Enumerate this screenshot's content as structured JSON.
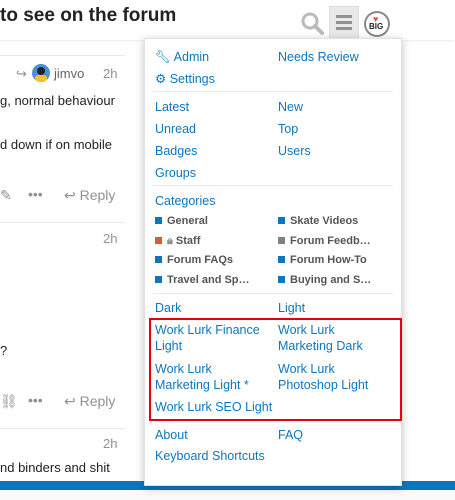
{
  "header": {
    "title": "to see on the forum",
    "search_icon": "search-icon",
    "menu_icon": "hamburger-icon",
    "avatar_icon": "user-avatar"
  },
  "posts": [
    {
      "user": "jimvo",
      "time": "2h",
      "lines": [
        "g, normal behaviour",
        "d down if on mobile"
      ],
      "more": "•••",
      "reply": "Reply"
    },
    {
      "time": "2h",
      "lines": [
        "?"
      ],
      "more": "•••",
      "reply": "Reply"
    },
    {
      "time": "2h",
      "lines": [
        "nd binders and shit"
      ]
    }
  ],
  "menu": {
    "top": [
      "Admin",
      "Needs Review",
      "Settings"
    ],
    "nav_left": [
      "Latest",
      "Unread",
      "Badges",
      "Groups"
    ],
    "nav_right": [
      "New",
      "Top",
      "Users"
    ],
    "categories_label": "Categories",
    "categories": [
      {
        "name": "General",
        "color": "#0e76bd"
      },
      {
        "name": "Skate Videos",
        "color": "#0e76bd"
      },
      {
        "name": "Staff",
        "color": "#e45735",
        "locked": true
      },
      {
        "name": "Forum Feedb…",
        "color": "#808281"
      },
      {
        "name": "Forum FAQs",
        "color": "#0e76bd"
      },
      {
        "name": "Forum How-To",
        "color": "#0e76bd"
      },
      {
        "name": "Travel and Sp…",
        "color": "#0e76bd"
      },
      {
        "name": "Buying and S…",
        "color": "#0e76bd"
      }
    ],
    "themes_basic": [
      "Dark",
      "Light"
    ],
    "themes_custom": [
      "Work Lurk Finance Light",
      "Work Lurk Marketing Dark",
      "Work Lurk Marketing Light *",
      "Work Lurk Photoshop Light",
      "Work Lurk SEO Light"
    ],
    "footer": [
      "About",
      "FAQ",
      "Keyboard Shortcuts"
    ]
  },
  "colors": {
    "link": "#0e76bd",
    "highlight": "#e0000f",
    "bar": "#0e76bd"
  }
}
